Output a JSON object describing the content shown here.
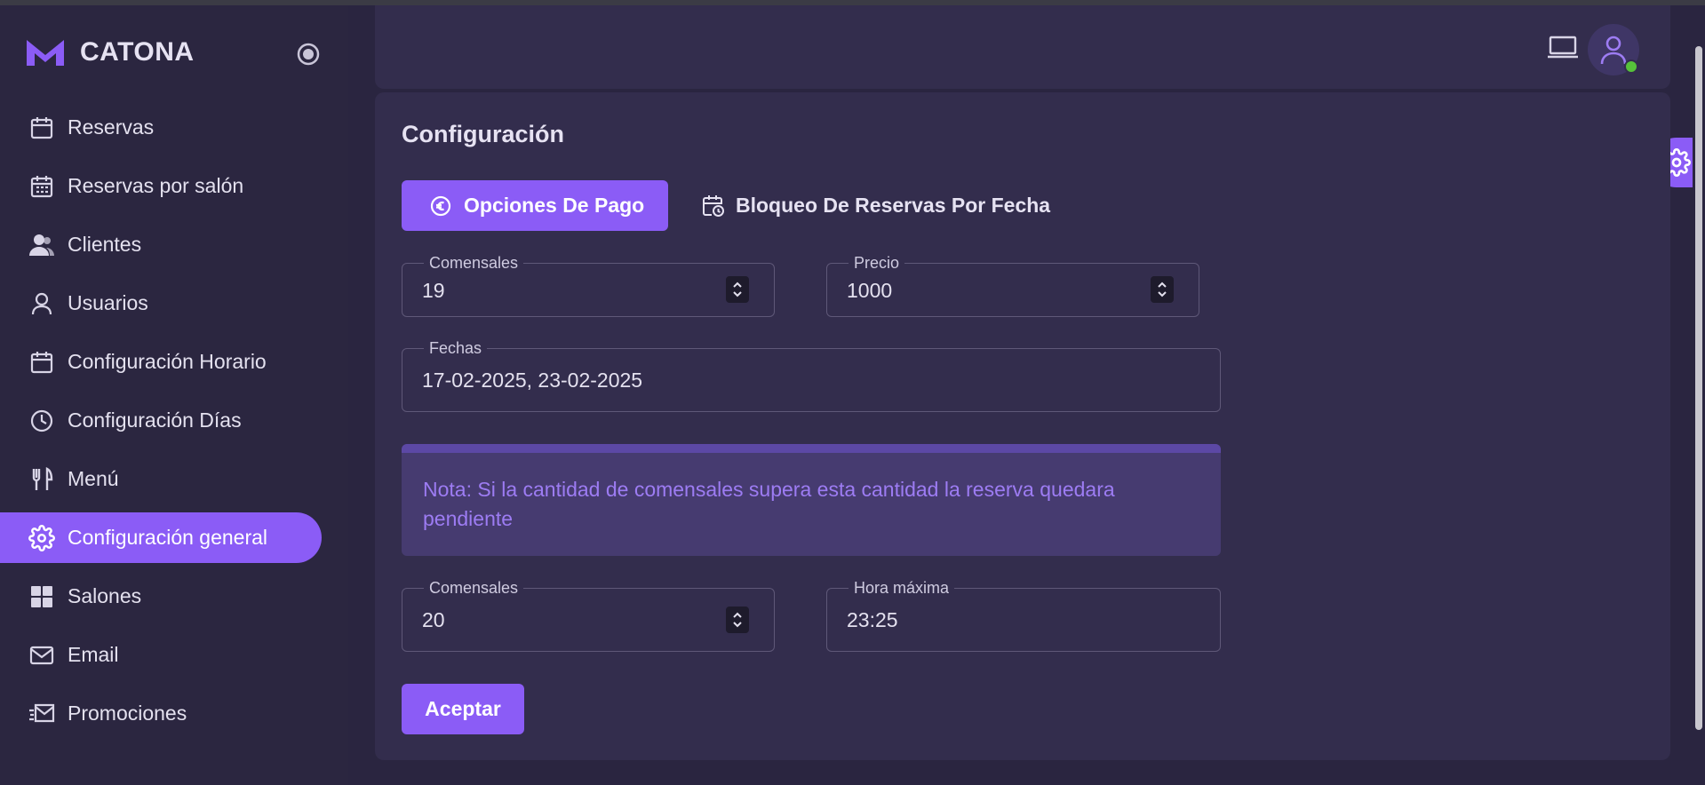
{
  "brand": {
    "name": "CATONA",
    "logo_icon": "m-logo-icon"
  },
  "colors": {
    "accent": "#8b5cf6",
    "background": "#2a2540",
    "surface": "#332d4d",
    "online": "#56c23a",
    "note_text": "#9d7cf3"
  },
  "sidebar": {
    "items": [
      {
        "label": "Reservas",
        "icon": "calendar-icon"
      },
      {
        "label": "Reservas por salón",
        "icon": "calendar-grid-icon"
      },
      {
        "label": "Clientes",
        "icon": "users-icon"
      },
      {
        "label": "Usuarios",
        "icon": "user-icon"
      },
      {
        "label": "Configuración Horario",
        "icon": "calendar-icon"
      },
      {
        "label": "Configuración Días",
        "icon": "clock-icon"
      },
      {
        "label": "Menú",
        "icon": "utensils-icon"
      },
      {
        "label": "Configuración general",
        "icon": "gear-icon",
        "active": true
      },
      {
        "label": "Salones",
        "icon": "grid-icon"
      },
      {
        "label": "Email",
        "icon": "mail-icon"
      },
      {
        "label": "Promociones",
        "icon": "mail-send-icon"
      }
    ]
  },
  "main": {
    "title": "Configuración",
    "tabs": [
      {
        "label": "Opciones De Pago",
        "icon": "euro-circle-icon",
        "active": true
      },
      {
        "label": "Bloqueo De Reservas Por Fecha",
        "icon": "calendar-clock-icon",
        "active": false
      }
    ],
    "form": {
      "comensales_1": {
        "label": "Comensales",
        "value": "19"
      },
      "precio": {
        "label": "Precio",
        "value": "1000"
      },
      "fechas": {
        "label": "Fechas",
        "value": "17-02-2025, 23-02-2025"
      },
      "note": "Nota: Si la cantidad de comensales supera esta cantidad la reserva quedara pendiente",
      "comensales_2": {
        "label": "Comensales",
        "value": "20"
      },
      "hora_maxima": {
        "label": "Hora máxima",
        "value": "23:25"
      },
      "accept_label": "Aceptar"
    }
  }
}
